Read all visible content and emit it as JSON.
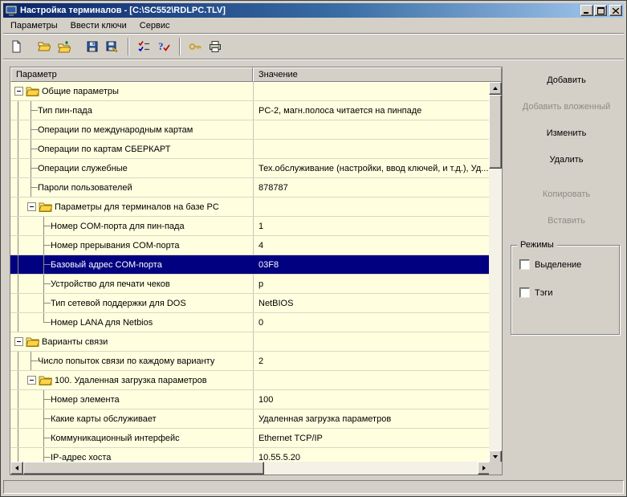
{
  "window": {
    "title": "Настройка терминалов - [C:\\SC552\\RDLPC.TLV]"
  },
  "menu": {
    "items": [
      {
        "name": "parameters",
        "label": "Параметры"
      },
      {
        "name": "enter-keys",
        "label": "Ввести ключи"
      },
      {
        "name": "service",
        "label": "Сервис"
      }
    ]
  },
  "toolbar": {
    "buttons": [
      {
        "name": "new-file",
        "icon": "new-document-icon"
      },
      {
        "name": "open-file",
        "icon": "open-folder-icon",
        "gap": true
      },
      {
        "name": "import-file",
        "icon": "import-folder-icon"
      },
      {
        "name": "save-file",
        "icon": "save-icon",
        "gap": true
      },
      {
        "name": "save-as",
        "icon": "save-edit-icon"
      },
      {
        "name": "verify",
        "icon": "verify-checks-icon",
        "sep": true
      },
      {
        "name": "check-query",
        "icon": "question-check-icon"
      },
      {
        "name": "keys",
        "icon": "key-icon",
        "sep": true
      },
      {
        "name": "print",
        "icon": "printer-icon"
      }
    ]
  },
  "grid": {
    "columns": [
      {
        "label": "Параметр"
      },
      {
        "label": "Значение"
      }
    ],
    "rows": [
      {
        "param": "Общие параметры",
        "value": "",
        "prefix": [
          "e"
        ],
        "folder": true,
        "selected": false
      },
      {
        "param": "Тип пин-пада",
        "value": "PC-2, магн.полоса читается на пинпаде",
        "prefix": [
          "v",
          "t"
        ],
        "folder": false,
        "selected": false
      },
      {
        "param": "Операции по международным картам",
        "value": "",
        "prefix": [
          "v",
          "t"
        ],
        "folder": false,
        "selected": false
      },
      {
        "param": "Операции по картам СБЕРКАРТ",
        "value": "",
        "prefix": [
          "v",
          "t"
        ],
        "folder": false,
        "selected": false
      },
      {
        "param": "Операции служебные",
        "value": "Тех.обслуживание (настройки, ввод ключей, и т.д.), Уд...",
        "prefix": [
          "v",
          "t"
        ],
        "folder": false,
        "selected": false
      },
      {
        "param": "Пароли пользователей",
        "value": "878787",
        "prefix": [
          "v",
          "t"
        ],
        "folder": false,
        "selected": false
      },
      {
        "param": "Параметры для терминалов на базе PC",
        "value": "",
        "prefix": [
          "v",
          "e"
        ],
        "folder": true,
        "selected": false
      },
      {
        "param": "Номер COM-порта для пин-пада",
        "value": "1",
        "prefix": [
          "v",
          "s",
          "t"
        ],
        "folder": false,
        "selected": false
      },
      {
        "param": "Номер прерывания COM-порта",
        "value": "4",
        "prefix": [
          "v",
          "s",
          "t"
        ],
        "folder": false,
        "selected": false
      },
      {
        "param": "Базовый адрес COM-порта",
        "value": "03F8",
        "prefix": [
          "v",
          "s",
          "t"
        ],
        "folder": false,
        "selected": true
      },
      {
        "param": "Устройство для печати чеков",
        "value": "p",
        "prefix": [
          "v",
          "s",
          "t"
        ],
        "folder": false,
        "selected": false
      },
      {
        "param": "Тип сетевой поддержки для DOS",
        "value": "NetBIOS",
        "prefix": [
          "v",
          "s",
          "t"
        ],
        "folder": false,
        "selected": false
      },
      {
        "param": "Номер LANA для Netbios",
        "value": "0",
        "prefix": [
          "v",
          "s",
          "l"
        ],
        "folder": false,
        "selected": false
      },
      {
        "param": "Варианты связи",
        "value": "",
        "prefix": [
          "e"
        ],
        "folder": true,
        "selected": false
      },
      {
        "param": "Число попыток связи по каждому варианту",
        "value": "2",
        "prefix": [
          "v",
          "t"
        ],
        "folder": false,
        "selected": false
      },
      {
        "param": "100. Удаленная загрузка параметров",
        "value": "",
        "prefix": [
          "v",
          "e"
        ],
        "folder": true,
        "selected": false
      },
      {
        "param": "Номер элемента",
        "value": "100",
        "prefix": [
          "v",
          "s",
          "t"
        ],
        "folder": false,
        "selected": false
      },
      {
        "param": "Какие карты обслуживает",
        "value": "Удаленная загрузка параметров",
        "prefix": [
          "v",
          "s",
          "t"
        ],
        "folder": false,
        "selected": false
      },
      {
        "param": "Коммуникационный интерфейс",
        "value": "Ethernet TCP/IP",
        "prefix": [
          "v",
          "s",
          "t"
        ],
        "folder": false,
        "selected": false
      },
      {
        "param": "IP-адрес хоста",
        "value": "10.55.5.20",
        "prefix": [
          "v",
          "s",
          "t"
        ],
        "folder": false,
        "selected": false
      }
    ]
  },
  "side_panel": {
    "buttons": [
      {
        "name": "add",
        "label": "Добавить",
        "enabled": true
      },
      {
        "name": "add-nested",
        "label": "Добавить вложенный",
        "enabled": false
      },
      {
        "name": "edit",
        "label": "Изменить",
        "enabled": true
      },
      {
        "name": "delete",
        "label": "Удалить",
        "enabled": true
      },
      {
        "name": "copy",
        "label": "Копировать",
        "enabled": false,
        "gap_before": true
      },
      {
        "name": "paste",
        "label": "Вставить",
        "enabled": false
      }
    ],
    "modes_group": {
      "title": "Режимы",
      "checkboxes": [
        {
          "name": "selection",
          "label": "Выделение",
          "checked": false
        },
        {
          "name": "tags",
          "label": "Тэги",
          "checked": false
        }
      ]
    }
  },
  "status_bar": {
    "text": ""
  },
  "colors": {
    "titlebar_start": "#0A246A",
    "titlebar_end": "#A6CAF0",
    "chrome": "#D4D0C8",
    "grid_background": "#FFFFE0",
    "selection_background": "#000080",
    "selection_text": "#FFFFFF"
  }
}
